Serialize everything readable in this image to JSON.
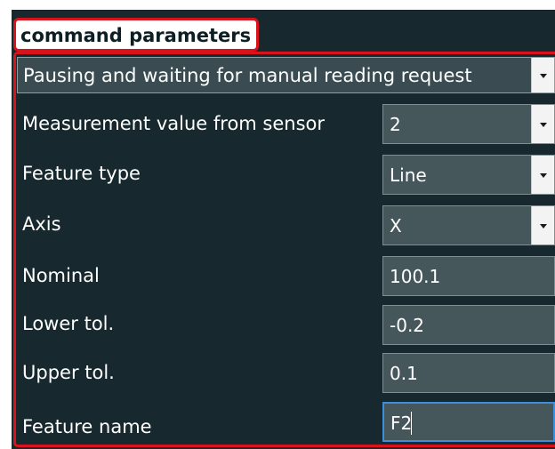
{
  "header": {
    "title": "command parameters"
  },
  "mode": {
    "value": "Pausing and waiting for manual reading request"
  },
  "params": [
    {
      "label": "Measurement value from sensor",
      "value": "2",
      "type": "select"
    },
    {
      "label": "Feature type",
      "value": "Line",
      "type": "select"
    },
    {
      "label": "Axis",
      "value": "X",
      "type": "select"
    },
    {
      "label": "Nominal",
      "value": "100.1",
      "type": "input"
    },
    {
      "label": "Lower tol.",
      "value": "-0.2",
      "type": "input"
    },
    {
      "label": "Upper tol.",
      "value": "0.1",
      "type": "input"
    },
    {
      "label": "Feature name",
      "value": "F2",
      "type": "input"
    }
  ],
  "colors": {
    "highlight": "#d9121b",
    "panel": "#17292e",
    "field": "#46575c",
    "focus": "#3d8fd9"
  },
  "icons": {
    "dropdown": "chevron-down-icon"
  }
}
